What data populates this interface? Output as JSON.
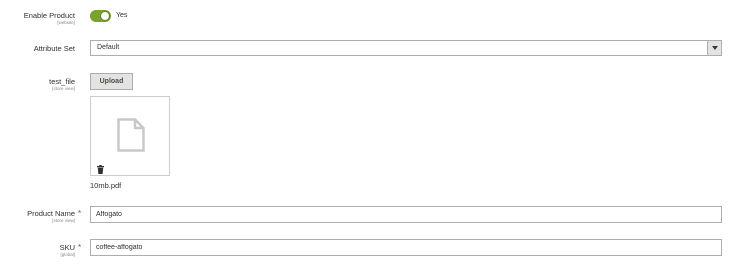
{
  "enable_product": {
    "label": "Enable Product",
    "scope": "[website]",
    "state_text": "Yes",
    "enabled": true,
    "accent": "#79a22e"
  },
  "attribute_set": {
    "label": "Attribute Set",
    "value": "Default"
  },
  "test_file": {
    "label": "test_file",
    "scope": "[store view]",
    "upload_label": "Upload",
    "file_name": "10mb.pdf",
    "preview_icon": "document-icon",
    "delete_icon": "trash-icon"
  },
  "product_name": {
    "label": "Product Name",
    "scope": "[store view]",
    "required_mark": "*",
    "value": "Affogato"
  },
  "sku": {
    "label": "SKU",
    "scope": "[global]",
    "required_mark": "*",
    "value": "coffee-affogato"
  },
  "colors": {
    "required": "#e22626",
    "border": "#adadad"
  }
}
